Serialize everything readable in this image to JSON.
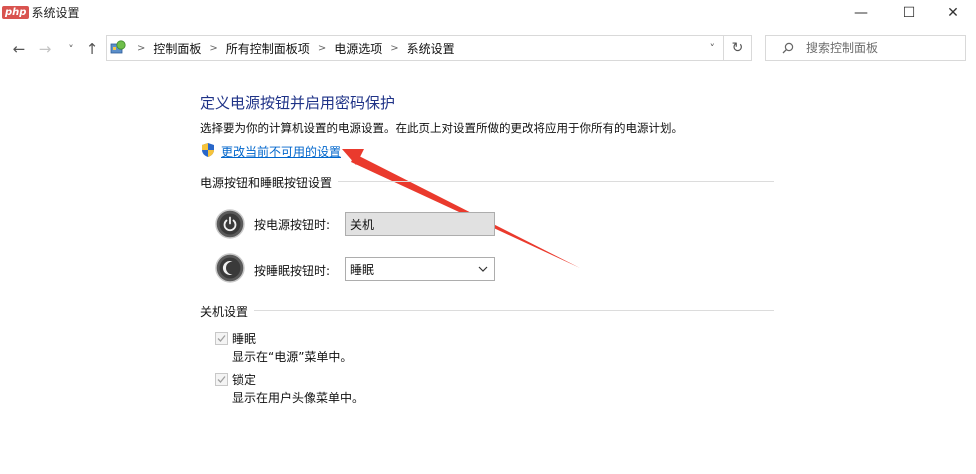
{
  "window": {
    "title": "系统设置",
    "watermark": "php",
    "controls": {
      "minimize": "—",
      "maximize": "☐",
      "close": "✕"
    }
  },
  "nav": {
    "back": "←",
    "forward": "→",
    "recent": "˅",
    "up": "↑",
    "dropdown": "˅",
    "refresh": "↻"
  },
  "breadcrumb": [
    "控制面板",
    "所有控制面板项",
    "电源选项",
    "系统设置"
  ],
  "search": {
    "placeholder": "搜索控制面板"
  },
  "main": {
    "title": "定义电源按钮并启用密码保护",
    "description": "选择要为你的计算机设置的电源设置。在此页上对设置所做的更改将应用于你所有的电源计划。",
    "change_link": "更改当前不可用的设置",
    "power_group": {
      "title": "电源按钮和睡眠按钮设置",
      "power_button_label": "按电源按钮时:",
      "power_button_value": "关机",
      "sleep_button_label": "按睡眠按钮时:",
      "sleep_button_value": "睡眠"
    },
    "shutdown_group": {
      "title": "关机设置",
      "items": [
        {
          "label": "睡眠",
          "description": "显示在“电源”菜单中。",
          "checked": true
        },
        {
          "label": "锁定",
          "description": "显示在用户头像菜单中。",
          "checked": true
        }
      ]
    }
  },
  "colors": {
    "title": "#1e3287",
    "link": "#0066cc",
    "arrow": "#ea3a2d"
  }
}
